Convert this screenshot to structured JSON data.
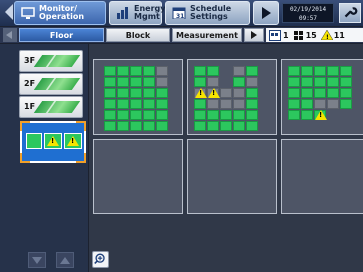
{
  "header": {
    "monitor_label": "Monitor/\nOperation",
    "energy_label": "Energy\nMgmt",
    "schedule_label": "Schedule\nSettings",
    "date": "02/19/2014",
    "time": "09:57"
  },
  "tabs": [
    {
      "label": "Floor",
      "active": true
    },
    {
      "label": "Block",
      "active": false
    },
    {
      "label": "Measurement",
      "active": false
    }
  ],
  "status": {
    "group_count": "1",
    "unit_count": "15",
    "alarm_count": "11"
  },
  "floors": [
    "3F",
    "2F",
    "1F"
  ],
  "colors": {
    "green": "#2cc75e",
    "gray": "#7b808a",
    "warning": "#f6e400",
    "selection": "#1f6fd1"
  }
}
